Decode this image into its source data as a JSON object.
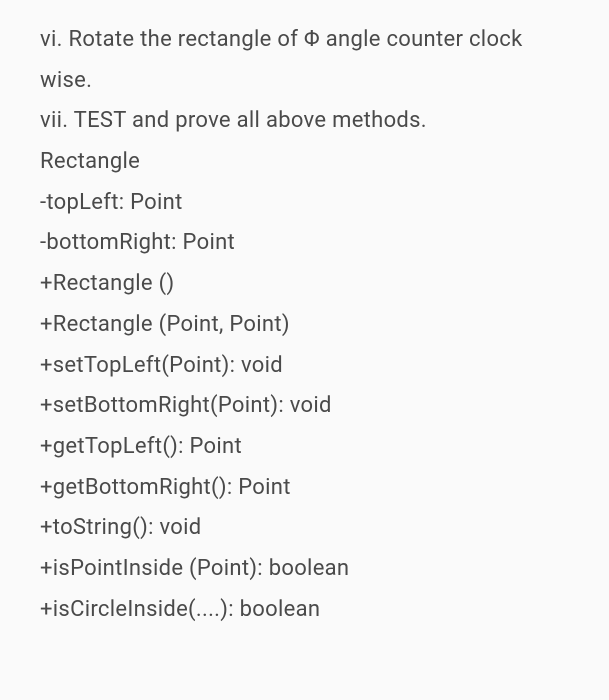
{
  "lines": [
    "vi. Rotate the rectangle of Φ angle counter clock wise.",
    "vii. TEST and prove all above methods.",
    "Rectangle",
    "-topLeft: Point",
    "-bottomRight: Point",
    "+Rectangle ()",
    "+Rectangle (Point, Point)",
    "+setTopLeft(Point): void",
    "+setBottomRight(Point): void",
    "+getTopLeft(): Point",
    "+getBottomRight(): Point",
    "+toString(): void",
    "+isPointInside (Point): boolean",
    "+isCircleInside(....): boolean"
  ]
}
